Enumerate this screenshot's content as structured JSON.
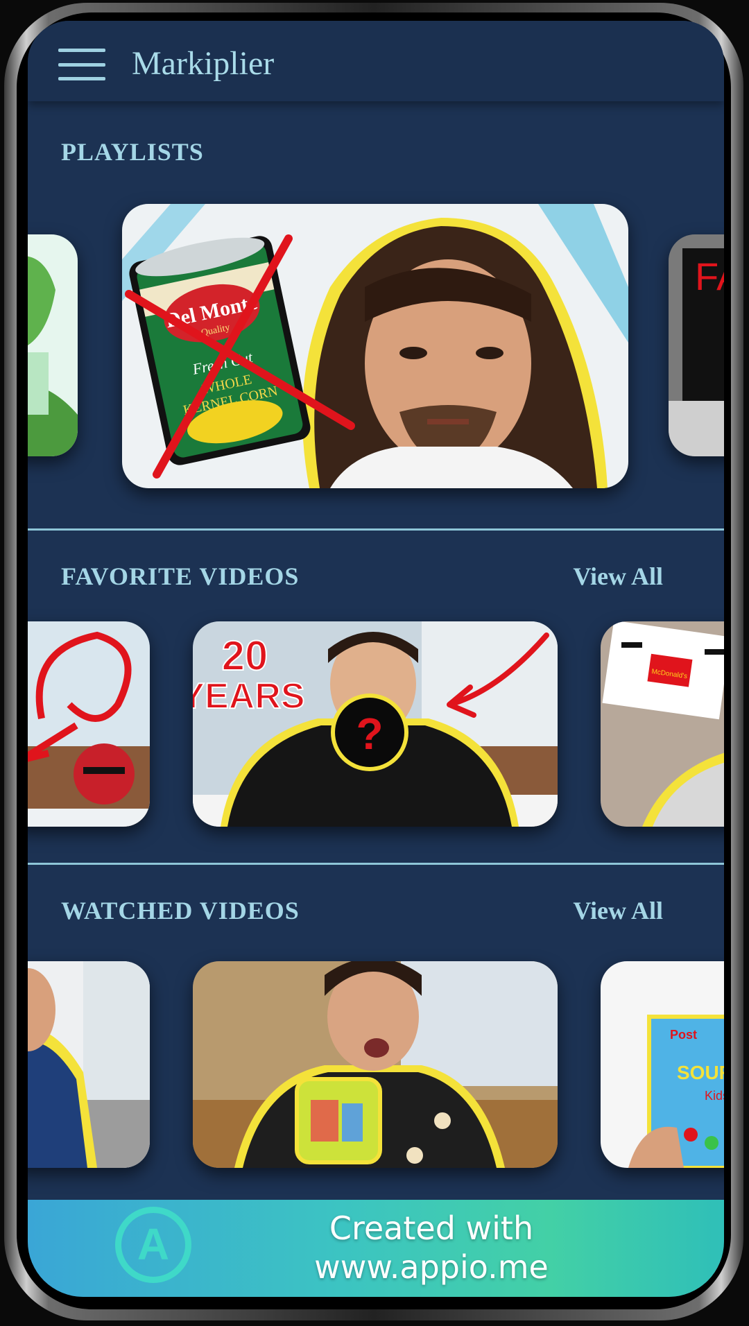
{
  "app": {
    "title": "Markiplier",
    "menu_icon": "hamburger-menu-icon"
  },
  "sections": {
    "playlists": {
      "title": "PLAYLISTS"
    },
    "favorites": {
      "title": "FAVORITE VIDEOS",
      "view_all": "View All"
    },
    "watched": {
      "title": "WATCHED VIDEOS",
      "view_all": "View All"
    }
  },
  "thumbnails": {
    "playlist_center": {
      "lines": [
        "Del Monte",
        "Quality",
        "Fresh Cut",
        "WHOLE",
        "KERNEL CORN"
      ]
    },
    "playlist_right": {
      "text": "FA F F"
    },
    "favorite_center": {
      "badge_line1": "20",
      "badge_line2": "YEARS",
      "mark": "?"
    },
    "favorite_right": {
      "text": "McDonald's"
    },
    "watched_right": {
      "brand": "Post",
      "product": "SOUR PATCH",
      "sub": "Kids"
    }
  },
  "banner": {
    "line1": "Created with",
    "line2": "www.appio.me",
    "logo_letter": "A"
  },
  "colors": {
    "background": "#1c3253",
    "appbar": "#1b3050",
    "accent_text": "#a4d6e6",
    "divider": "#8ec6d8"
  }
}
